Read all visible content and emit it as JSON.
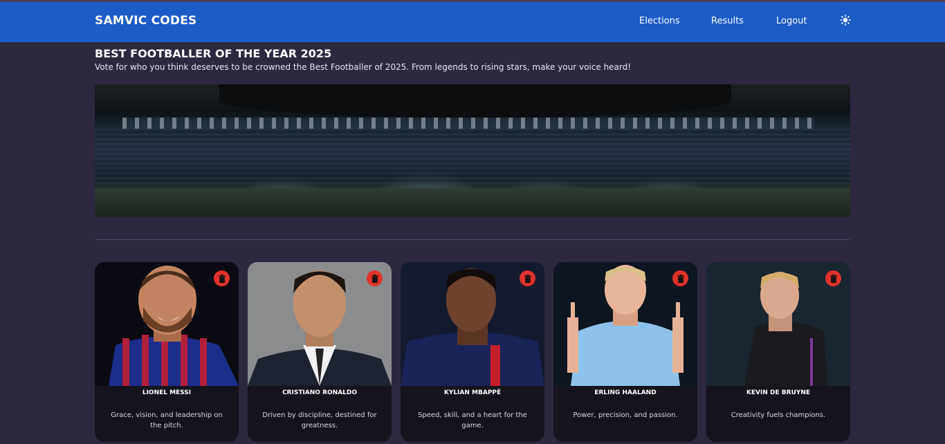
{
  "nav": {
    "brand": "SAMVIC CODES",
    "links": [
      "Elections",
      "Results",
      "Logout"
    ],
    "theme_icon": "sun-icon"
  },
  "election": {
    "title": "BEST FOOTBALLER OF THE YEAR 2025",
    "description": "Vote for who you think deserves to be crowned the Best Footballer of 2025. From legends to rising stars, make your voice heard!"
  },
  "candidates": [
    {
      "name": "LIONEL MESSI",
      "motto": "Grace, vision, and leadership on the pitch."
    },
    {
      "name": "CRISTIANO RONALDO",
      "motto": "Driven by discipline, destined for greatness."
    },
    {
      "name": "KYLIAN MBAPPÉ",
      "motto": "Speed, skill, and a heart for the game."
    },
    {
      "name": "ERLING HAALAND",
      "motto": "Power, precision, and passion."
    },
    {
      "name": "KEVIN DE BRUYNE",
      "motto": "Creativity fuels champions."
    }
  ],
  "colors": {
    "navbar": "#1b5cc5",
    "background": "#2d283e",
    "card": "#15131c",
    "delete": "#e0322c"
  }
}
